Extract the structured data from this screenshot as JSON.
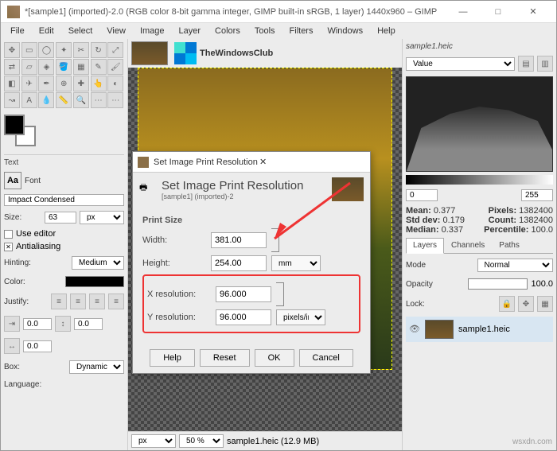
{
  "title": "*[sample1] (imported)-2.0 (RGB color 8-bit gamma integer, GIMP built-in sRGB, 1 layer) 1440x960 – GIMP",
  "menu": {
    "file": "File",
    "edit": "Edit",
    "select": "Select",
    "view": "View",
    "image": "Image",
    "layer": "Layer",
    "colors": "Colors",
    "tools": "Tools",
    "filters": "Filters",
    "windows": "Windows",
    "help": "Help"
  },
  "logo_text": "TheWindowsClub",
  "left": {
    "text_hdr": "Text",
    "font_lbl": "Font",
    "font": "Impact Condensed",
    "size_lbl": "Size:",
    "size": "63",
    "size_unit": "px",
    "use_editor": "Use editor",
    "antialias": "Antialiasing",
    "hinting_lbl": "Hinting:",
    "hinting": "Medium",
    "color_lbl": "Color:",
    "justify_lbl": "Justify:",
    "box_lbl": "Box:",
    "box": "Dynamic",
    "lang_lbl": "Language:",
    "sp1": "0.0",
    "sp2": "0.0",
    "sp3": "0.0"
  },
  "status": {
    "unit": "px",
    "zoom": "50 %",
    "filename": "sample1.heic (12.9 MB)"
  },
  "right": {
    "filename": "sample1.heic",
    "channel": "Value",
    "range_lo": "0",
    "range_hi": "255",
    "mean_l": "Mean:",
    "mean": "0.377",
    "pixels_l": "Pixels:",
    "pixels": "1382400",
    "std_l": "Std dev:",
    "std": "0.179",
    "count_l": "Count:",
    "count": "1382400",
    "median_l": "Median:",
    "median": "0.337",
    "pct_l": "Percentile:",
    "pct": "100.0",
    "tab_layers": "Layers",
    "tab_channels": "Channels",
    "tab_paths": "Paths",
    "mode_l": "Mode",
    "mode": "Normal",
    "opacity_l": "Opacity",
    "opacity": "100.0",
    "lock_l": "Lock:",
    "layer_name": "sample1.heic"
  },
  "modal": {
    "title": "Set Image Print Resolution",
    "heading": "Set Image Print Resolution",
    "sub": "[sample1] (imported)-2",
    "print_size": "Print Size",
    "width_l": "Width:",
    "width": "381.00",
    "height_l": "Height:",
    "height": "254.00",
    "size_unit": "mm",
    "xres_l": "X resolution:",
    "xres": "96.000",
    "yres_l": "Y resolution:",
    "yres": "96.000",
    "res_unit": "pixels/in",
    "help": "Help",
    "reset": "Reset",
    "ok": "OK",
    "cancel": "Cancel"
  }
}
